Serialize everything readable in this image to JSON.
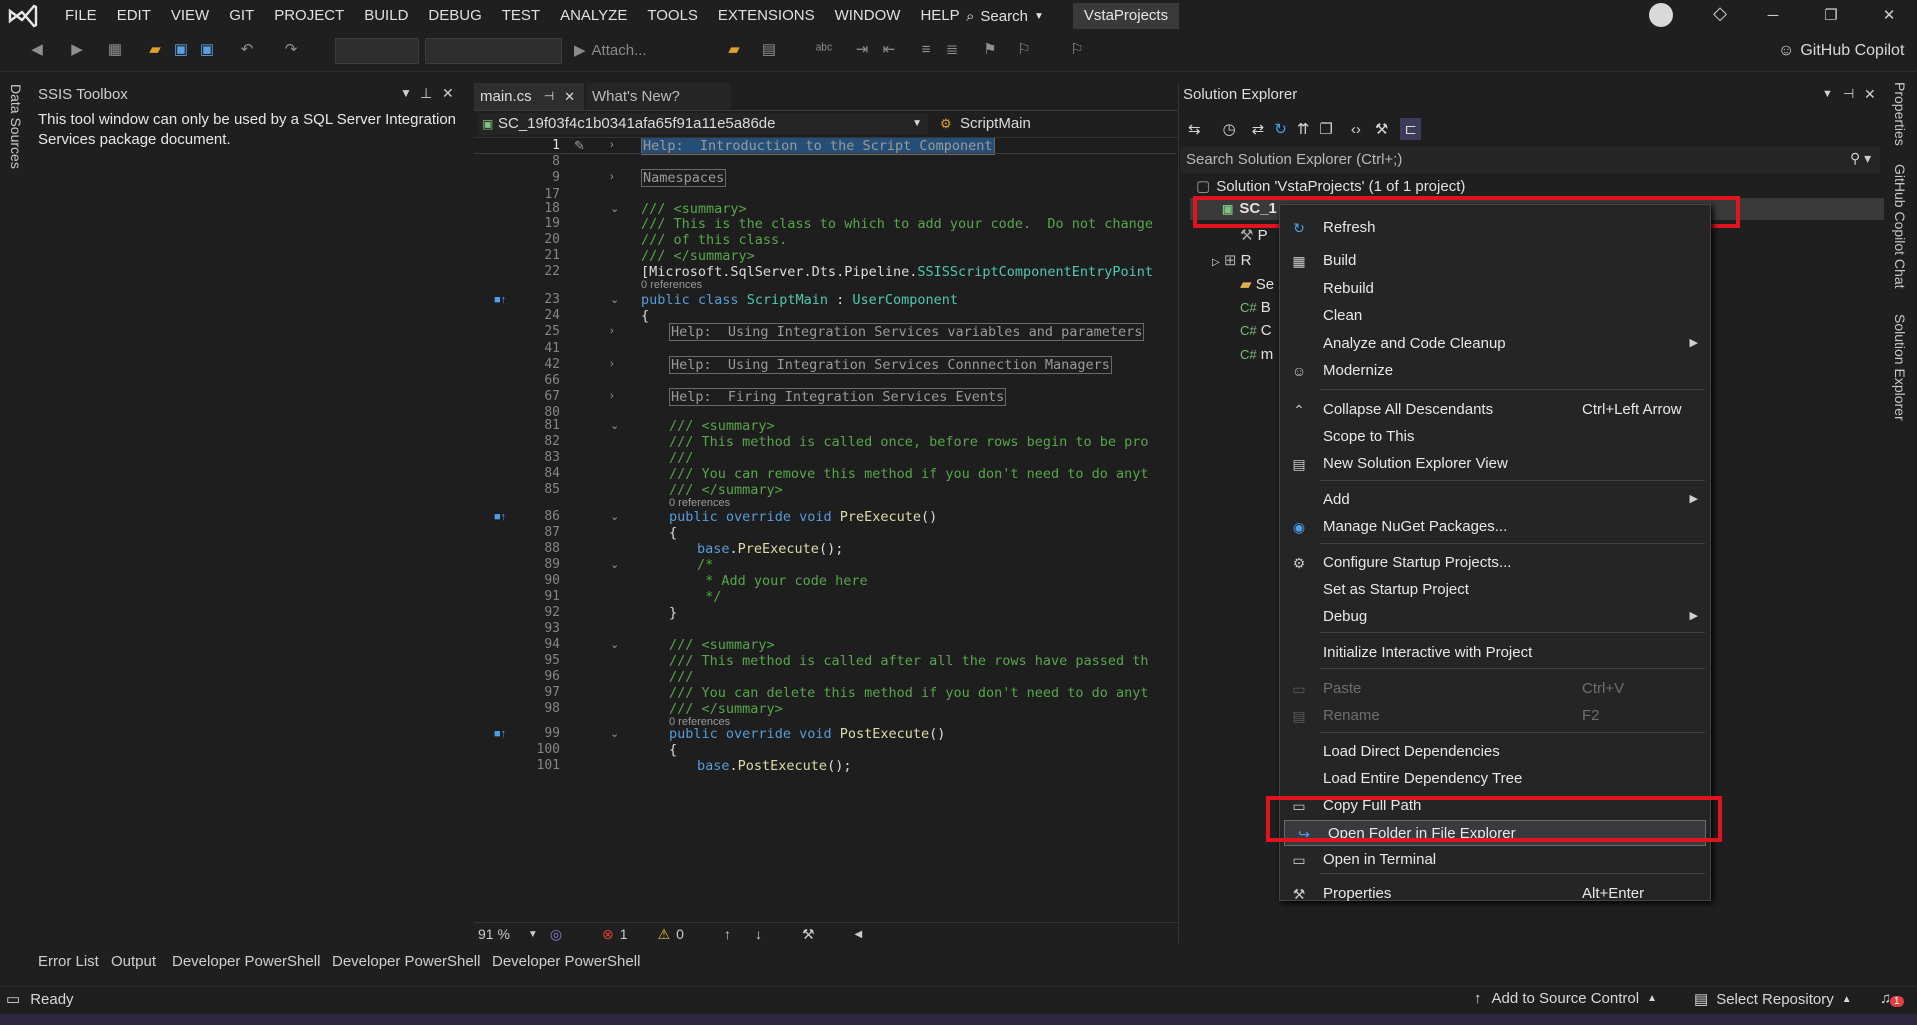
{
  "menubar": {
    "items": [
      "FILE",
      "EDIT",
      "VIEW",
      "GIT",
      "PROJECT",
      "BUILD",
      "DEBUG",
      "TEST",
      "ANALYZE",
      "TOOLS",
      "EXTENSIONS",
      "WINDOW",
      "HELP"
    ],
    "search_label": "Search",
    "project_name": "VstaProjects"
  },
  "toolbar": {
    "attach_label": "Attach...",
    "copilot_label": "GitHub Copilot"
  },
  "left_strip": {
    "label": "Data Sources"
  },
  "ssis_toolbox": {
    "title": "SSIS Toolbox",
    "message": "This tool window can only be used by a SQL Server Integration Services package document."
  },
  "editor": {
    "tabs": [
      "main.cs",
      "What's New?"
    ],
    "nav_left": "SC_19f03f4c1b0341afa65f91a11e5a86de",
    "nav_right": "ScriptMain",
    "zoom": "91 %",
    "errors": "1",
    "warnings": "0",
    "refs_label": "0 references",
    "lines": [
      {
        "n": "1",
        "t": "Help:  Introduction to the Script Component"
      },
      {
        "n": "8",
        "t": ""
      },
      {
        "n": "9",
        "t": "Namespaces"
      },
      {
        "n": "17",
        "t": ""
      },
      {
        "n": "18",
        "t": "/// <summary>"
      },
      {
        "n": "19",
        "t": "/// This is the class to which to add your code.  Do not change"
      },
      {
        "n": "20",
        "t": "/// of this class."
      },
      {
        "n": "21",
        "t": "/// </summary>"
      },
      {
        "n": "22",
        "t": "[Microsoft.SqlServer.Dts.Pipeline.SSISScriptComponentEntryPoint"
      },
      {
        "n": "23",
        "t": "public class ScriptMain : UserComponent"
      },
      {
        "n": "24",
        "t": "{"
      },
      {
        "n": "25",
        "t": "Help:  Using Integration Services variables and parameters"
      },
      {
        "n": "41",
        "t": ""
      },
      {
        "n": "42",
        "t": "Help:  Using Integration Services Connnection Managers"
      },
      {
        "n": "66",
        "t": ""
      },
      {
        "n": "67",
        "t": "Help:  Firing Integration Services Events"
      },
      {
        "n": "80",
        "t": ""
      },
      {
        "n": "81",
        "t": "/// <summary>"
      },
      {
        "n": "82",
        "t": "/// This method is called once, before rows begin to be pro"
      },
      {
        "n": "83",
        "t": "///"
      },
      {
        "n": "84",
        "t": "/// You can remove this method if you don't need to do anyt"
      },
      {
        "n": "85",
        "t": "/// </summary>"
      },
      {
        "n": "86",
        "t": "public override void PreExecute()"
      },
      {
        "n": "87",
        "t": "{"
      },
      {
        "n": "88",
        "t": "base.PreExecute();"
      },
      {
        "n": "89",
        "t": "/*"
      },
      {
        "n": "90",
        "t": " * Add your code here"
      },
      {
        "n": "91",
        "t": " */"
      },
      {
        "n": "92",
        "t": "}"
      },
      {
        "n": "93",
        "t": ""
      },
      {
        "n": "94",
        "t": "/// <summary>"
      },
      {
        "n": "95",
        "t": "/// This method is called after all the rows have passed th"
      },
      {
        "n": "96",
        "t": "///"
      },
      {
        "n": "97",
        "t": "/// You can delete this method if you don't need to do anyt"
      },
      {
        "n": "98",
        "t": "/// </summary>"
      },
      {
        "n": "99",
        "t": "public override void PostExecute()"
      },
      {
        "n": "100",
        "t": "{"
      },
      {
        "n": "101",
        "t": "base.PostExecute();"
      }
    ]
  },
  "solution_explorer": {
    "title": "Solution Explorer",
    "search_placeholder": "Search Solution Explorer (Ctrl+;)",
    "solution_label": "Solution 'VstaProjects' (1 of 1 project)",
    "project_label": "SC_1",
    "tree_fragments": [
      "P",
      "R",
      "Se",
      "B",
      "C",
      "m"
    ]
  },
  "context_menu": {
    "items": [
      {
        "label": "Refresh",
        "shortcut": "",
        "icon": "refresh-icon",
        "disabled": false,
        "submenu": false
      },
      {
        "label": "Build",
        "shortcut": "",
        "icon": "build-icon",
        "disabled": false,
        "submenu": false
      },
      {
        "label": "Rebuild",
        "shortcut": "",
        "icon": "",
        "disabled": false,
        "submenu": false
      },
      {
        "label": "Clean",
        "shortcut": "",
        "icon": "",
        "disabled": false,
        "submenu": false
      },
      {
        "label": "Analyze and Code Cleanup",
        "shortcut": "",
        "icon": "",
        "disabled": false,
        "submenu": true
      },
      {
        "label": "Modernize",
        "shortcut": "",
        "icon": "copilot-icon",
        "disabled": false,
        "submenu": false
      },
      {
        "label": "Collapse All Descendants",
        "shortcut": "Ctrl+Left Arrow",
        "icon": "collapse-icon",
        "disabled": false,
        "submenu": false
      },
      {
        "label": "Scope to This",
        "shortcut": "",
        "icon": "",
        "disabled": false,
        "submenu": false
      },
      {
        "label": "New Solution Explorer View",
        "shortcut": "",
        "icon": "window-icon",
        "disabled": false,
        "submenu": false
      },
      {
        "label": "Add",
        "shortcut": "",
        "icon": "",
        "disabled": false,
        "submenu": true
      },
      {
        "label": "Manage NuGet Packages...",
        "shortcut": "",
        "icon": "nuget-icon",
        "disabled": false,
        "submenu": false
      },
      {
        "label": "Configure Startup Projects...",
        "shortcut": "",
        "icon": "gear-icon",
        "disabled": false,
        "submenu": false
      },
      {
        "label": "Set as Startup Project",
        "shortcut": "",
        "icon": "",
        "disabled": false,
        "submenu": false
      },
      {
        "label": "Debug",
        "shortcut": "",
        "icon": "",
        "disabled": false,
        "submenu": true
      },
      {
        "label": "Initialize Interactive with Project",
        "shortcut": "",
        "icon": "",
        "disabled": false,
        "submenu": false
      },
      {
        "label": "Paste",
        "shortcut": "Ctrl+V",
        "icon": "paste-icon",
        "disabled": true,
        "submenu": false
      },
      {
        "label": "Rename",
        "shortcut": "F2",
        "icon": "rename-icon",
        "disabled": true,
        "submenu": false
      },
      {
        "label": "Load Direct Dependencies",
        "shortcut": "",
        "icon": "",
        "disabled": false,
        "submenu": false
      },
      {
        "label": "Load Entire Dependency Tree",
        "shortcut": "",
        "icon": "",
        "disabled": false,
        "submenu": false
      },
      {
        "label": "Copy Full Path",
        "shortcut": "",
        "icon": "copy-icon",
        "disabled": false,
        "submenu": false
      },
      {
        "label": "Open Folder in File Explorer",
        "shortcut": "",
        "icon": "open-folder-icon",
        "disabled": false,
        "submenu": false
      },
      {
        "label": "Open in Terminal",
        "shortcut": "",
        "icon": "terminal-icon",
        "disabled": false,
        "submenu": false
      },
      {
        "label": "Properties",
        "shortcut": "Alt+Enter",
        "icon": "wrench-icon",
        "disabled": false,
        "submenu": false
      }
    ]
  },
  "right_strip": {
    "labels": [
      "Properties",
      "GitHub Copilot Chat",
      "Solution Explorer"
    ]
  },
  "bottom_tabs": [
    "Error List",
    "Output",
    "Developer PowerShell",
    "Developer PowerShell",
    "Developer PowerShell"
  ],
  "status": {
    "ready": "Ready",
    "source_control": "Add to Source Control",
    "repository": "Select Repository",
    "notifications": "1"
  },
  "colors": {
    "highlight_box": "#e0141e",
    "selection": "#264f78",
    "comment": "#57a64a",
    "keyword": "#569cd6",
    "type": "#4ec9b0"
  }
}
